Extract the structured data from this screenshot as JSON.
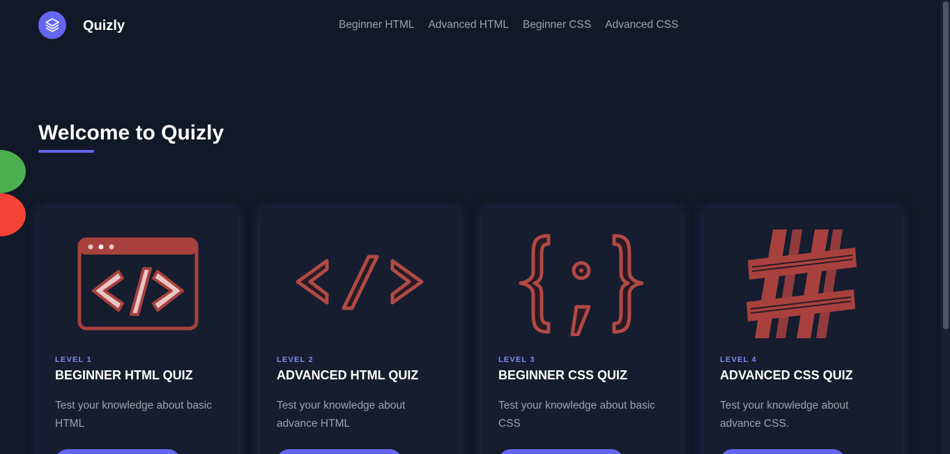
{
  "app": {
    "brand": "Quizly",
    "logo_icon": "layers-icon",
    "accent_color": "#6366f1"
  },
  "nav": {
    "items": [
      {
        "label": "Beginner HTML"
      },
      {
        "label": "Advanced HTML"
      },
      {
        "label": "Beginner CSS"
      },
      {
        "label": "Advanced CSS"
      }
    ]
  },
  "hero": {
    "title": "Welcome to Quizly"
  },
  "cards": [
    {
      "icon": "browser-code-icon",
      "level": "LEVEL 1",
      "title": "BEGINNER HTML QUIZ",
      "description": "Test your knowledge about basic HTML"
    },
    {
      "icon": "code-tag-icon",
      "level": "LEVEL 2",
      "title": "ADVANCED HTML QUIZ",
      "description": "Test your knowledge about advance HTML"
    },
    {
      "icon": "curly-braces-icon",
      "level": "LEVEL 3",
      "title": "BEGINNER CSS QUIZ",
      "description": "Test your knowledge about basic CSS"
    },
    {
      "icon": "hashtag-icon",
      "level": "LEVEL 4",
      "title": "ADVANCED CSS QUIZ",
      "description": "Test your knowledge about advance CSS."
    }
  ]
}
